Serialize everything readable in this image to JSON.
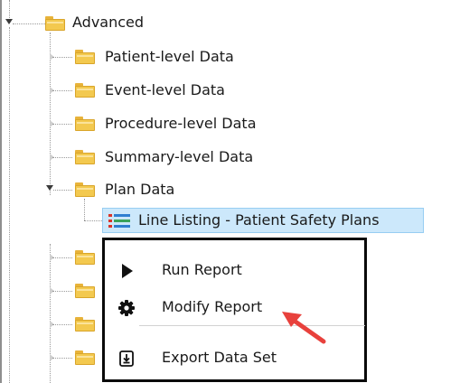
{
  "tree": {
    "root": {
      "label": "Advanced",
      "icon": "folder-icon",
      "expanded": true
    },
    "children": [
      {
        "label": "Patient-level Data",
        "icon": "folder-icon"
      },
      {
        "label": "Event-level Data",
        "icon": "folder-icon"
      },
      {
        "label": "Procedure-level Data",
        "icon": "folder-icon"
      },
      {
        "label": "Summary-level Data",
        "icon": "folder-icon"
      },
      {
        "label": "Plan Data",
        "icon": "folder-icon",
        "expanded": true
      }
    ],
    "selected_leaf": {
      "label": "Line Listing - Patient Safety Plans",
      "icon": "list-report-icon"
    }
  },
  "context_menu": {
    "items": [
      {
        "label": "Run Report",
        "icon": "play-icon"
      },
      {
        "label": "Modify Report",
        "icon": "gear-icon"
      },
      {
        "label": "Export Data Set",
        "icon": "export-icon"
      }
    ]
  },
  "annotation": {
    "icon": "red-pointer-arrow-icon",
    "color": "#e8413c"
  },
  "colors": {
    "selection_bg": "#cce8fb",
    "selection_border": "#97cdf2",
    "folder": "#f3c94f",
    "menu_border": "#0a0a0a"
  }
}
